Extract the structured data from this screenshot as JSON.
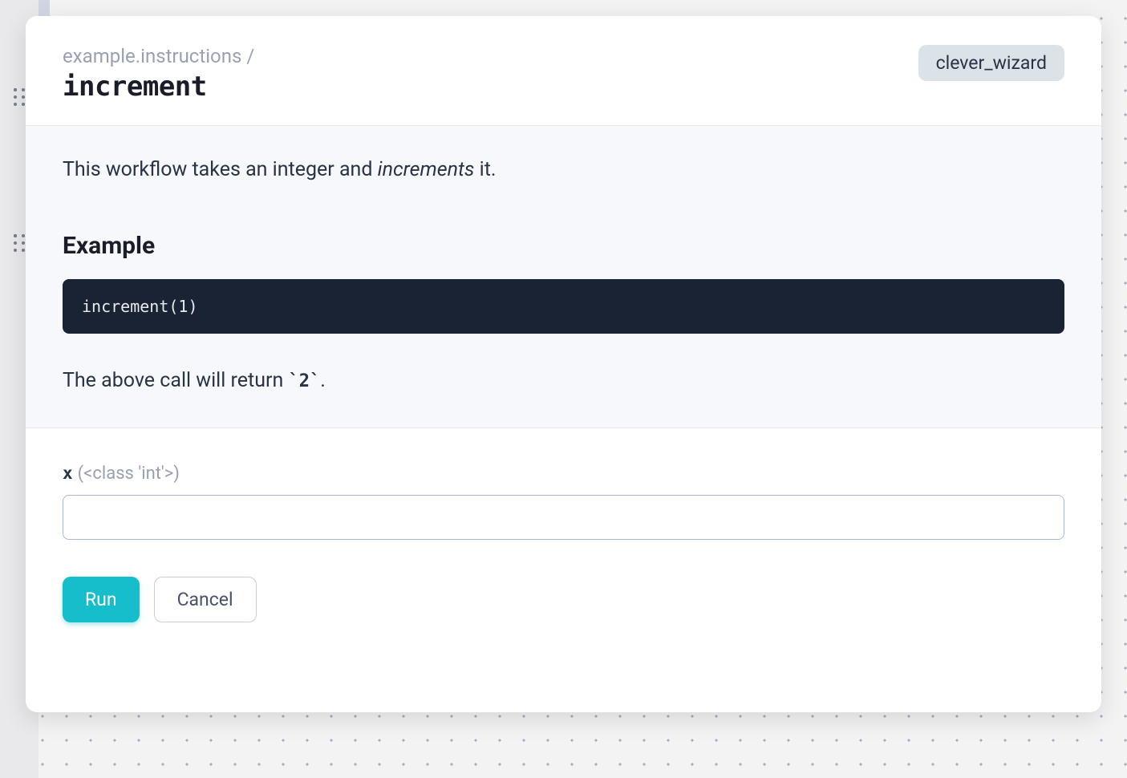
{
  "header": {
    "path": "example.instructions /",
    "title": "increment",
    "badge": "clever_wizard"
  },
  "body": {
    "description_prefix": "This workflow takes an integer and ",
    "description_emphasis": "increments",
    "description_suffix": " it.",
    "example_heading": "Example",
    "code": "increment(1)",
    "result_prefix": "The above call will return ",
    "result_code": "`2`",
    "result_suffix": "."
  },
  "form": {
    "field_name": "x",
    "field_type": "(<class 'int'>)",
    "input_value": ""
  },
  "buttons": {
    "run": "Run",
    "cancel": "Cancel"
  }
}
